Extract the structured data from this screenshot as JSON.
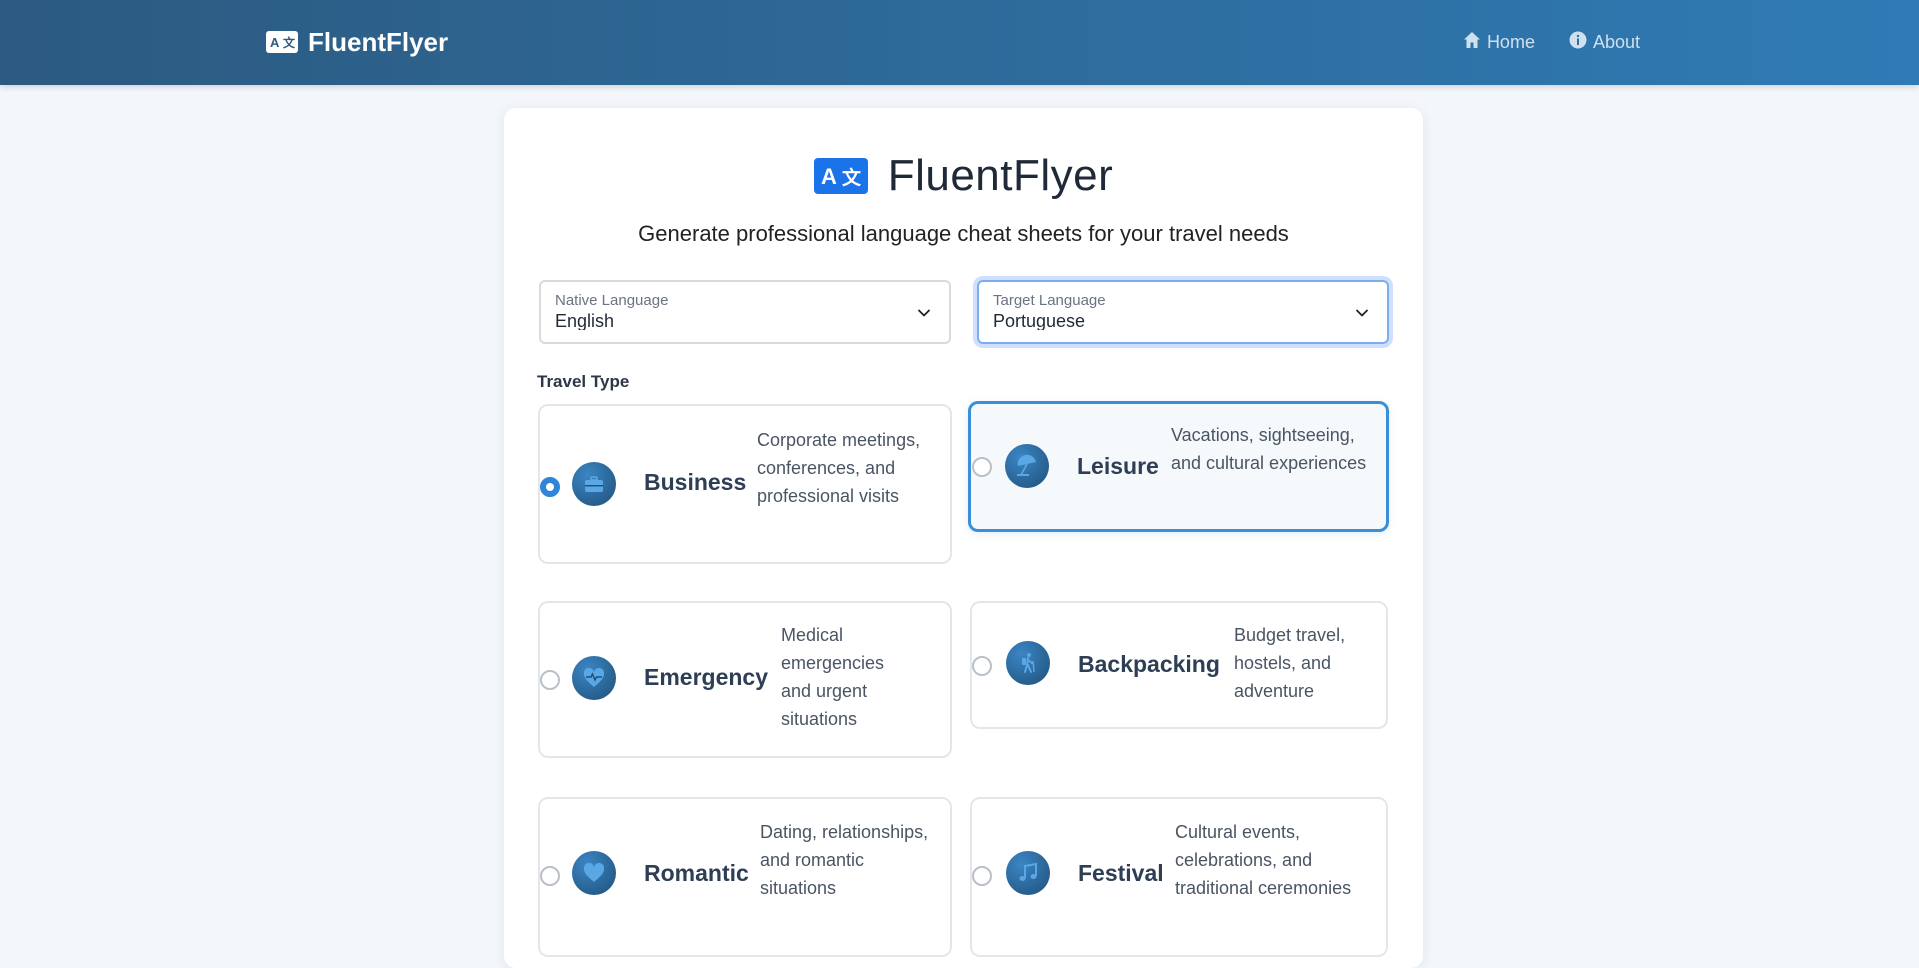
{
  "nav": {
    "brand": "FluentFlyer",
    "links": [
      {
        "label": "Home",
        "icon": "home-icon"
      },
      {
        "label": "About",
        "icon": "info-icon"
      }
    ]
  },
  "hero": {
    "title": "FluentFlyer",
    "subtitle": "Generate professional language cheat sheets for your travel needs"
  },
  "native_language": {
    "label": "Native Language",
    "value": "English"
  },
  "target_language": {
    "label": "Target Language",
    "value": "Portuguese"
  },
  "travel_type": {
    "label": "Travel Type",
    "selected": "Business",
    "options": [
      {
        "title": "Business",
        "description": "Corporate meetings, conferences, and professional visits",
        "icon": "briefcase-icon"
      },
      {
        "title": "Leisure",
        "description": "Vacations, sightseeing, and cultural experiences",
        "icon": "umbrella-beach-icon"
      },
      {
        "title": "Emergency",
        "description": "Medical emergencies and urgent situations",
        "icon": "heart-pulse-icon"
      },
      {
        "title": "Backpacking",
        "description": "Budget travel, hostels, and adventure",
        "icon": "hiker-icon"
      },
      {
        "title": "Romantic",
        "description": "Dating, relationships, and romantic situations",
        "icon": "heart-icon"
      },
      {
        "title": "Festival",
        "description": "Cultural events, celebrations, and traditional ceremonies",
        "icon": "music-note-icon"
      }
    ]
  },
  "colors": {
    "navbar_start": "#2c5a80",
    "navbar_end": "#2f7bb5",
    "accent": "#2f86d8",
    "brand_icon": "#1a73e8"
  }
}
